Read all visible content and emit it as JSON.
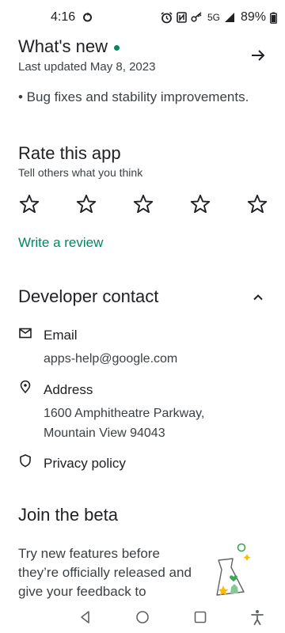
{
  "status_bar": {
    "time": "4:16",
    "network": "5G",
    "battery": "89%"
  },
  "whats_new": {
    "title": "What's new",
    "updated": "Last updated May 8, 2023",
    "note": "• Bug fixes and stability improvements.",
    "accent_color": "#01875f"
  },
  "rate": {
    "title": "Rate this app",
    "subtitle": "Tell others what you think",
    "star_count": 5,
    "write_review": "Write a review"
  },
  "developer_contact": {
    "title": "Developer contact",
    "email_label": "Email",
    "email_value": "apps-help@google.com",
    "address_label": "Address",
    "address_line1": "1600 Amphitheatre Parkway,",
    "address_line2": "Mountain View 94043",
    "privacy_label": "Privacy policy"
  },
  "beta": {
    "title": "Join the beta",
    "description": "Try new features before they’re officially released and give your feedback to"
  },
  "icons": {
    "sync": "sync-icon",
    "alarm": "alarm-icon",
    "nfc": "nfc-icon",
    "vpn_key": "key-icon",
    "signal": "signal-icon",
    "battery": "battery-icon",
    "arrow": "arrow-right-icon",
    "star": "star-outline-icon",
    "chevron": "chevron-up-icon",
    "email": "mail-icon",
    "location": "location-pin-icon",
    "privacy": "shield-icon",
    "back": "nav-back-icon",
    "home": "nav-home-icon",
    "recents": "nav-recents-icon",
    "accessibility": "accessibility-icon"
  }
}
